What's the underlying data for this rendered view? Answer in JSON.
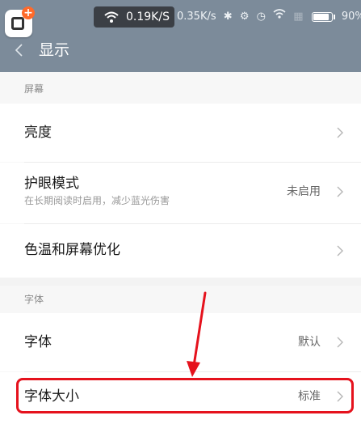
{
  "status_bar": {
    "speed_primary": "0.19K/S",
    "speed_secondary": "0.35K/s",
    "battery": "90%"
  },
  "header": {
    "title": "显示"
  },
  "sections": {
    "screen": {
      "label": "屏幕",
      "items": [
        {
          "title": "亮度"
        },
        {
          "title": "护眼模式",
          "subtitle": "在长期阅读时启用，减少蓝光伤害",
          "value": "未启用"
        },
        {
          "title": "色温和屏幕优化"
        }
      ]
    },
    "font": {
      "label": "字体",
      "items": [
        {
          "title": "字体",
          "value": "默认"
        },
        {
          "title": "字体大小",
          "value": "标准"
        }
      ]
    }
  },
  "colors": {
    "header_bg": "#7c8b9a",
    "annotation": "#e5121d"
  },
  "icons": [
    "wifi-icon",
    "bluetooth-icon",
    "alarm-icon",
    "battery-icon",
    "back-icon",
    "chevron-right-icon"
  ]
}
